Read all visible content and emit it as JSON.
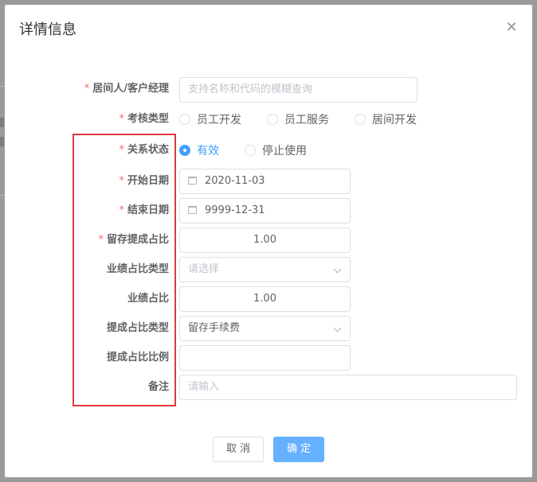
{
  "dialog": {
    "title": "详情信息",
    "close_icon": "close-icon"
  },
  "form": {
    "agent": {
      "label": "居间人/客户经理",
      "required": "*",
      "placeholder": "支持名称和代码的模糊查询"
    },
    "assess_type": {
      "label": "考核类型",
      "required": "*",
      "options": [
        "员工开发",
        "员工服务",
        "居间开发"
      ],
      "selected": ""
    },
    "relation_status": {
      "label": "关系状态",
      "required": "*",
      "options": [
        "有效",
        "停止使用"
      ],
      "selected": "有效"
    },
    "start_date": {
      "label": "开始日期",
      "required": "*",
      "value": "2020-11-03",
      "icon": "calendar-icon"
    },
    "end_date": {
      "label": "结束日期",
      "required": "*",
      "value": "9999-12-31",
      "icon": "calendar-icon"
    },
    "retain_ratio": {
      "label": "留存提成占比",
      "required": "*",
      "value": "1.00"
    },
    "perf_ratio_type": {
      "label": "业绩占比类型",
      "placeholder": "请选择",
      "icon": "chevron-down-icon"
    },
    "perf_ratio": {
      "label": "业绩占比",
      "value": "1.00"
    },
    "commission_ratio_type": {
      "label": "提成占比类型",
      "value": "留存手续费",
      "icon": "chevron-down-icon"
    },
    "commission_ratio": {
      "label": "提成占比比例",
      "value": ""
    },
    "remark": {
      "label": "备注",
      "placeholder": "请输入"
    }
  },
  "footer": {
    "cancel_label": "取消",
    "confirm_label": "确定"
  },
  "colors": {
    "primary": "#409eff",
    "required": "#f56c6c",
    "highlight": "#e0393e"
  }
}
